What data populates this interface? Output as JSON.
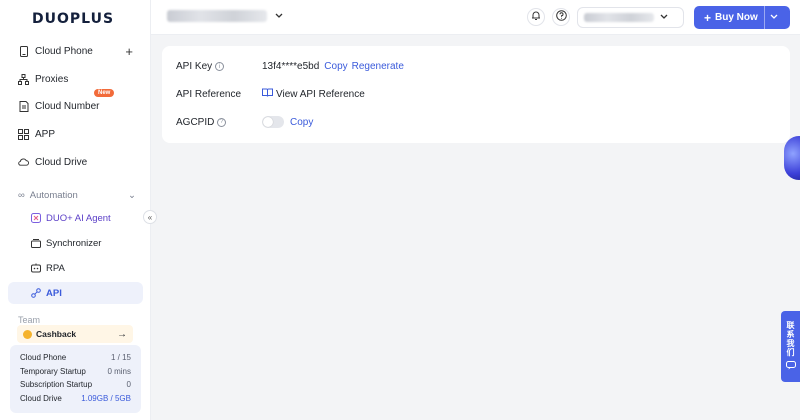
{
  "brand": {
    "logo_text": "DUOPLUS"
  },
  "sidebar": {
    "items": [
      {
        "label": "Cloud Phone",
        "icon": "phone-icon"
      },
      {
        "label": "Proxies",
        "icon": "network-icon"
      },
      {
        "label": "Cloud Number",
        "icon": "sim-icon",
        "badge": "New"
      },
      {
        "label": "APP",
        "icon": "grid-icon"
      },
      {
        "label": "Cloud Drive",
        "icon": "cloud-icon"
      }
    ],
    "automation": {
      "label": "Automation",
      "items": [
        {
          "label": "DUO+ AI Agent",
          "icon": "ai-icon"
        },
        {
          "label": "Synchronizer",
          "icon": "sync-icon"
        },
        {
          "label": "RPA",
          "icon": "rpa-icon"
        },
        {
          "label": "API",
          "icon": "api-icon",
          "active": true
        }
      ]
    },
    "team_label": "Team",
    "cashback": {
      "label": "Cashback"
    },
    "stats": [
      {
        "label": "Cloud Phone",
        "value": "1 / 15"
      },
      {
        "label": "Temporary Startup",
        "value": "0 mins"
      },
      {
        "label": "Subscription Startup",
        "value": "0"
      },
      {
        "label": "Cloud Drive",
        "value": "1.09GB / 5GB"
      }
    ]
  },
  "topbar": {
    "buy_label": "Buy Now"
  },
  "api": {
    "key_label": "API Key",
    "key_value": "13f4****e5bd",
    "copy_label": "Copy",
    "regenerate_label": "Regenerate",
    "reference_label": "API Reference",
    "view_reference_label": "View API Reference",
    "agcpid_label": "AGCPID",
    "agcpid_copy_label": "Copy",
    "agcpid_enabled": false
  },
  "contact": {
    "label": "联系我们"
  },
  "colors": {
    "accent": "#4a63e7",
    "link": "#3b5bdb",
    "badge": "#f26b3a"
  }
}
